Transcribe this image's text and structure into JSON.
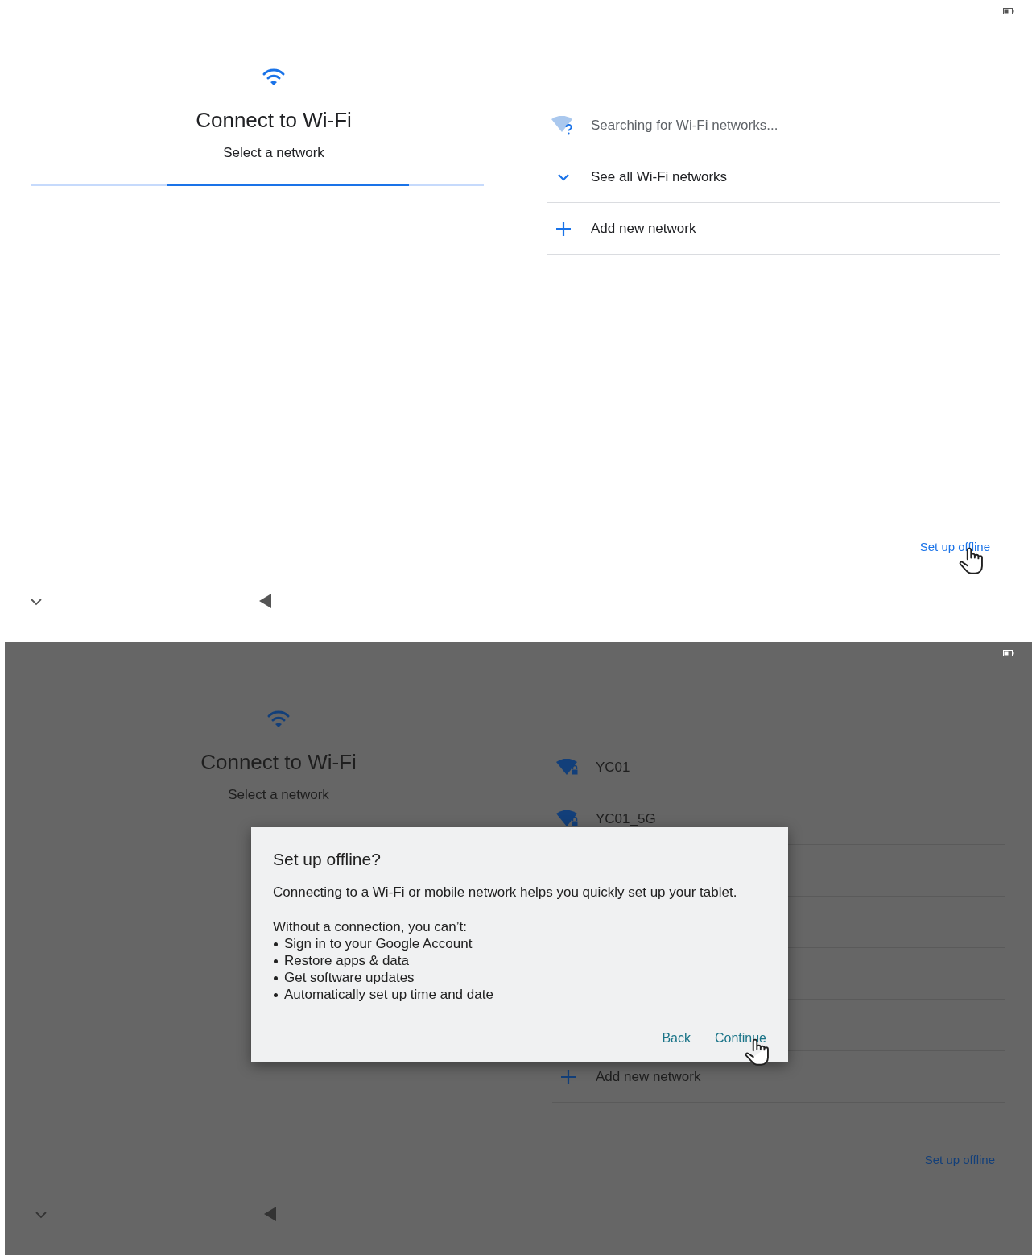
{
  "screens": [
    {
      "dimmed": false,
      "title": "Connect to Wi-Fi",
      "subtitle": "Select a network",
      "rows": [
        {
          "kind": "searching",
          "label": "Searching for Wi-Fi networks..."
        },
        {
          "kind": "expand",
          "label": "See all Wi-Fi networks"
        },
        {
          "kind": "add",
          "label": "Add new network"
        }
      ],
      "footer_link": {
        "label": "Set up offline",
        "hovered": true
      }
    },
    {
      "dimmed": true,
      "title": "Connect to Wi-Fi",
      "subtitle": "Select a network",
      "rows": [
        {
          "kind": "network",
          "label": "YC01"
        },
        {
          "kind": "network",
          "label": "YC01_5G"
        },
        {
          "kind": "covered"
        },
        {
          "kind": "covered"
        },
        {
          "kind": "covered"
        },
        {
          "kind": "covered"
        },
        {
          "kind": "add",
          "label": "Add new network"
        }
      ],
      "footer_link": {
        "label": "Set up offline",
        "hovered": false
      },
      "dialog": {
        "title": "Set up offline?",
        "message": "Connecting to a Wi-Fi or mobile network helps you quickly set up your tablet.",
        "list_intro": "Without a connection, you can’t:",
        "bullets": [
          "Sign in to your Google Account",
          "Restore apps & data",
          "Get software updates",
          "Automatically set up time and date"
        ],
        "buttons": [
          {
            "label": "Back",
            "hovered": false
          },
          {
            "label": "Continue",
            "hovered": true
          }
        ]
      }
    }
  ]
}
